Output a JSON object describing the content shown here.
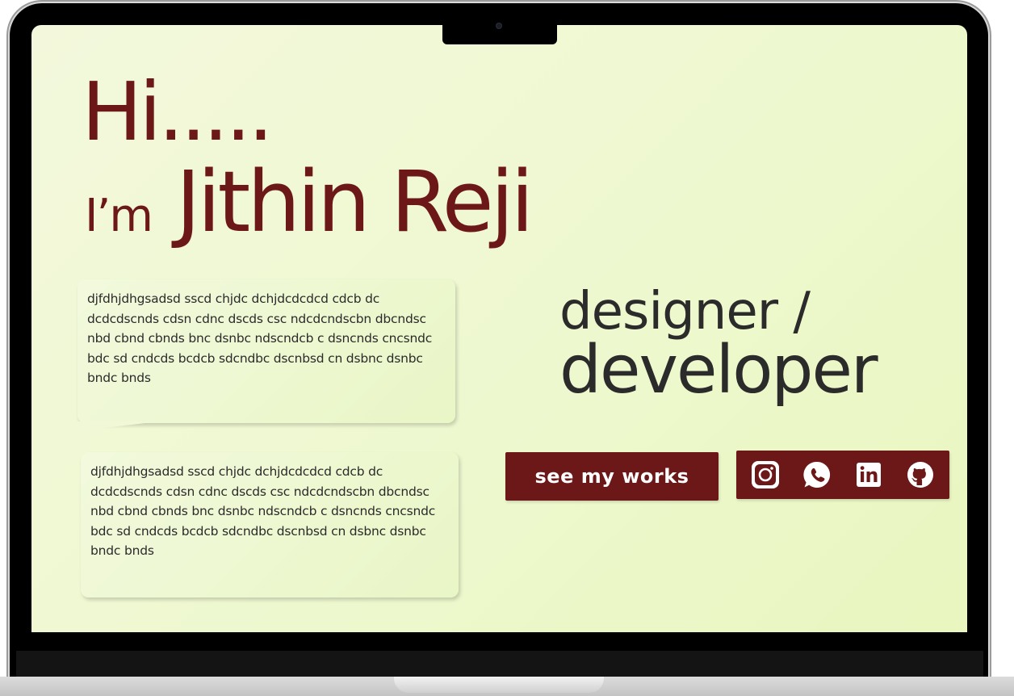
{
  "hero": {
    "greeting": "Hi.....",
    "intro_prefix": "I’m",
    "name": "Jithin Reji"
  },
  "about": {
    "paragraph_1": "djfdhjdhgsadsd sscd chjdc dchjdcdcdcd cdcb dc dcdcdscnds cdsn cdnc dscds csc ndcdcndscbn dbcndsc nbd cbnd cbnds bnc dsnbc ndscndcb c dsncnds cncsndc bdc sd cndcds bcdcb sdcndbc dscnbsd cn dsbnc dsnbc bndc bnds",
    "paragraph_2": "djfdhjdhgsadsd sscd chjdc dchjdcdcdcd cdcb dc dcdcdscnds cdsn cdnc dscds csc ndcdcndscbn dbcndsc nbd cbnd cbnds bnc dsnbc ndscndcb c dsncnds cncsndc bdc sd cndcds bcdcb sdcndbc dscnbsd cn dsbnc dsnbc bndc bnds"
  },
  "role": {
    "line_1": "designer /",
    "line_2": "developer"
  },
  "cta": {
    "label": "see my works"
  },
  "social": {
    "icons": [
      "instagram-icon",
      "whatsapp-icon",
      "linkedin-icon",
      "github-icon"
    ]
  },
  "colors": {
    "accent": "#6d1818",
    "text_dark": "#2b2b2b",
    "background": "#eef8cf",
    "device_frame": "#000000"
  }
}
